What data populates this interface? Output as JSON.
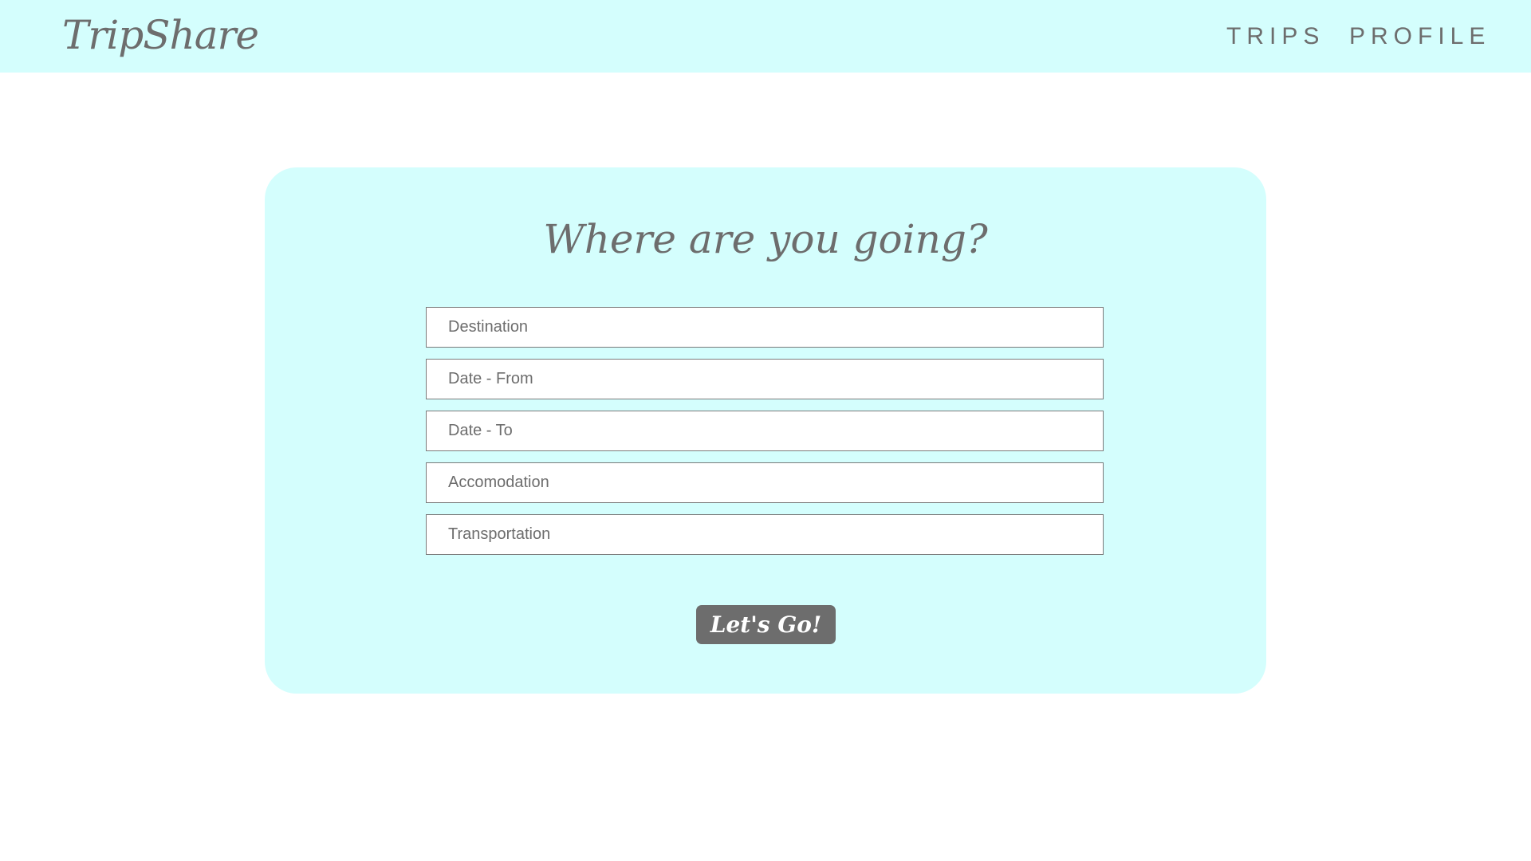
{
  "header": {
    "logo": "TripShare",
    "nav": {
      "trips": "TRIPS",
      "profile": "PROFILE"
    }
  },
  "form": {
    "heading": "Where are you going?",
    "fields": [
      {
        "placeholder": "Destination"
      },
      {
        "placeholder": "Date - From"
      },
      {
        "placeholder": "Date - To"
      },
      {
        "placeholder": "Accomodation"
      },
      {
        "placeholder": "Transportation"
      }
    ],
    "submit_label": "Let's Go!"
  },
  "colors": {
    "header_bg": "#d4fefd",
    "card_bg": "#d4fefd",
    "text": "#6d6d6d",
    "button_bg": "#6d6d6d",
    "button_text": "#ffffff"
  }
}
